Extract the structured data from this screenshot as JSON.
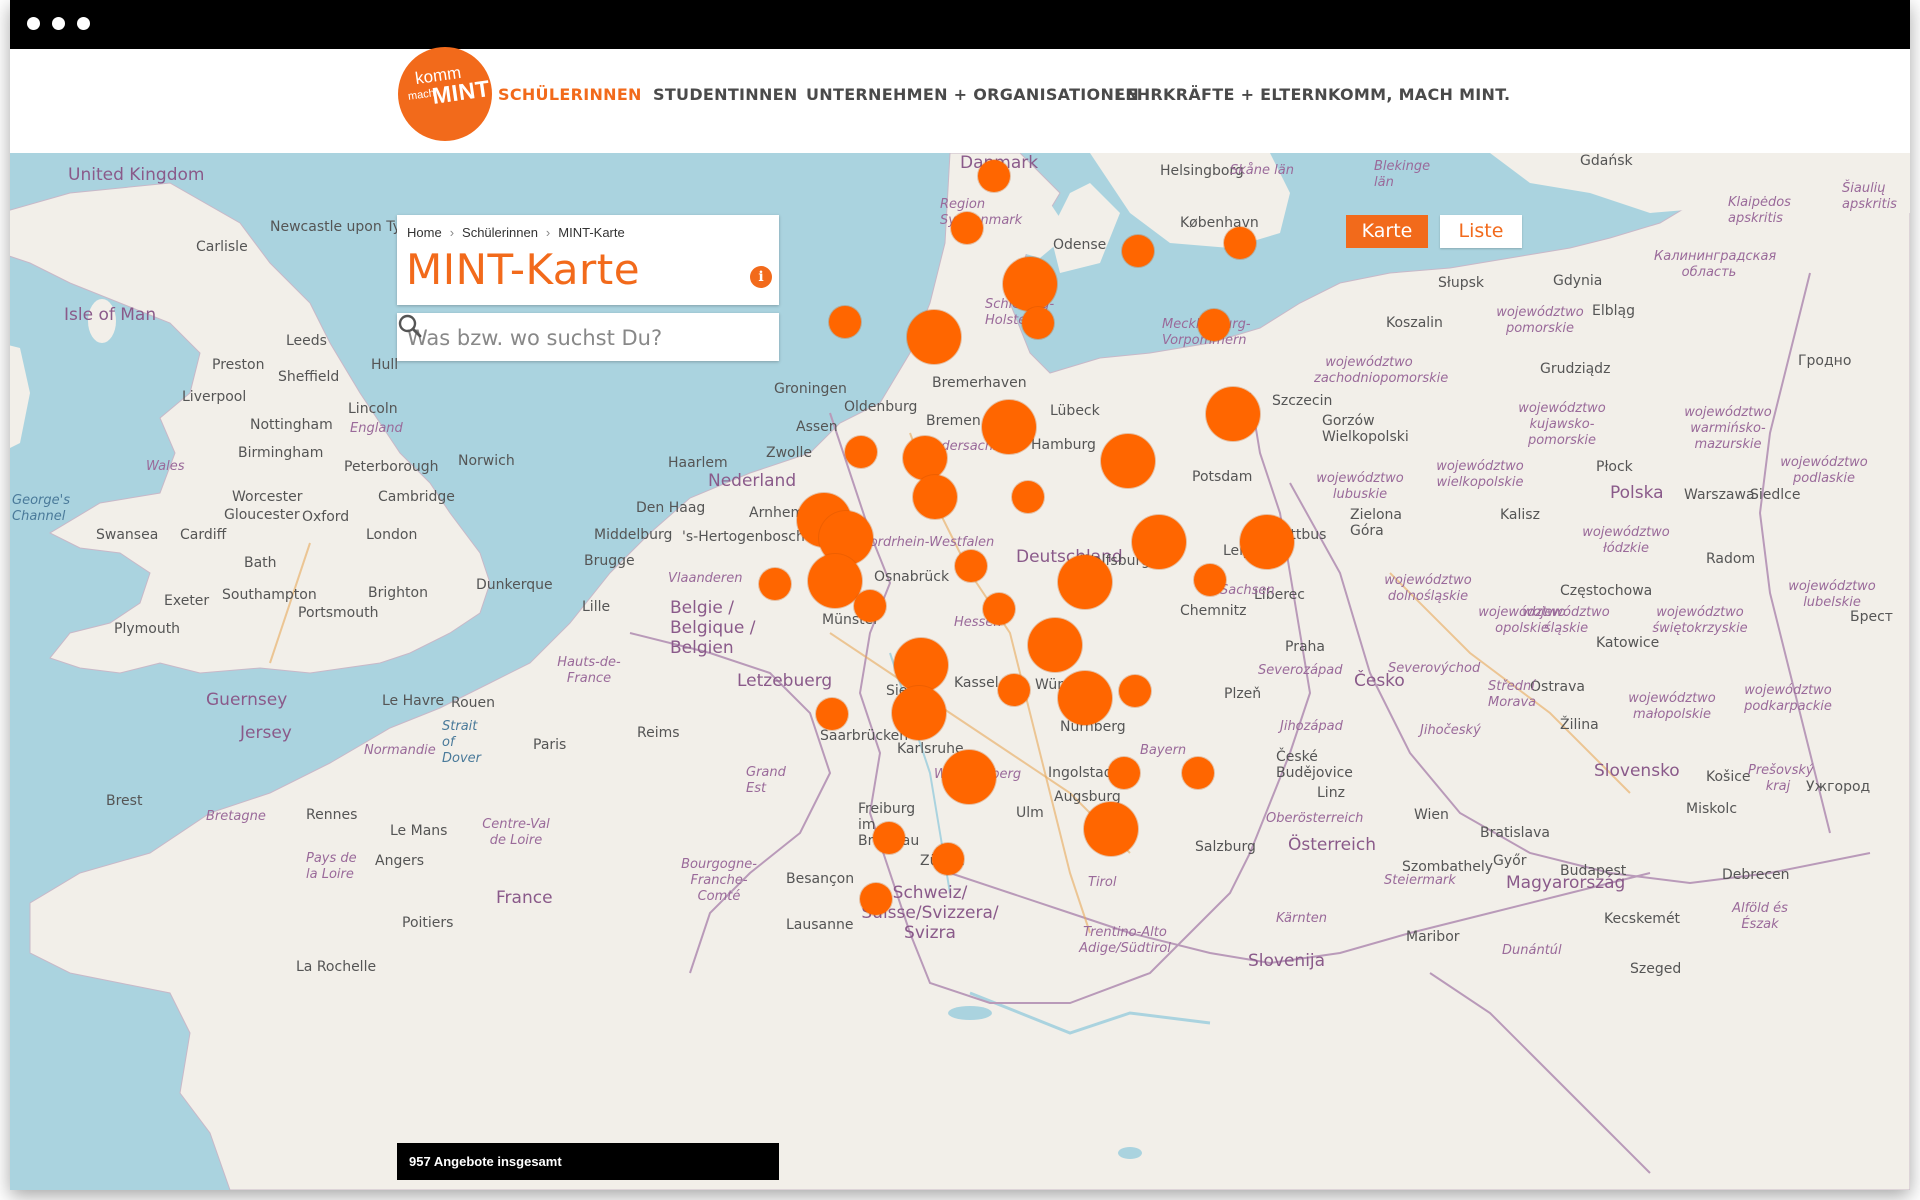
{
  "logo": {
    "line1": "komm",
    "line2": "mach",
    "line3": "MINT"
  },
  "nav": {
    "items": [
      {
        "label": "SCHÜLERINNEN",
        "active": true
      },
      {
        "label": "STUDENTINNEN",
        "active": false
      },
      {
        "label": "UNTERNEHMEN + ORGANISATIONEN",
        "active": false
      },
      {
        "label": "LEHRKRÄFTE + ELTERN",
        "active": false
      },
      {
        "label": "KOMM, MACH MINT.",
        "active": false
      }
    ]
  },
  "breadcrumb": {
    "home": "Home",
    "section": "Schülerinnen",
    "current": "MINT-Karte",
    "separator": "›"
  },
  "page": {
    "title": "MINT-Karte",
    "info_icon": "info-icon",
    "info_glyph": "i"
  },
  "search": {
    "placeholder": "Was bzw. wo suchst Du?",
    "value": "",
    "icon": "search-icon"
  },
  "view_toggle": {
    "map_label": "Karte",
    "list_label": "Liste",
    "active": "Karte"
  },
  "footer": {
    "total_text": "957 Angebote insgesamt"
  },
  "colors": {
    "accent": "#f26a1b",
    "marker": "#ff6600",
    "water": "#aad3df",
    "land": "#f2efe9",
    "nav_text": "#4a4a4a"
  },
  "map_labels": {
    "countries": [
      "United Kingdom",
      "Isle of Man",
      "Nederland",
      "Deutschland",
      "Belgie / Belgique / Belgien",
      "France",
      "Letzebuerg",
      "Schweiz/ Suisse/Svizzera/ Svizra",
      "Česko",
      "Österreich",
      "Polska",
      "Slovensko",
      "Magyarország",
      "Danmark",
      "Guernsey",
      "Jersey",
      "Slovenija"
    ],
    "cities": [
      "Newcastle upon Tyne",
      "Carlisle",
      "Leeds",
      "Preston",
      "Hull",
      "Sheffield",
      "Liverpool",
      "Lincoln",
      "Nottingham",
      "Birmingham",
      "Peterborough",
      "Norwich",
      "Worcester",
      "Cambridge",
      "Gloucester",
      "Oxford",
      "Swansea",
      "Cardiff",
      "London",
      "Bath",
      "Brighton",
      "Southampton",
      "Portsmouth",
      "Exeter",
      "Plymouth",
      "Dunkerque",
      "Lille",
      "Le Havre",
      "Rouen",
      "Paris",
      "Reims",
      "Brest",
      "Rennes",
      "Le Mans",
      "Angers",
      "Poitiers",
      "La Rochelle",
      "Besançon",
      "Lausanne",
      "Zürich",
      "Haarlem",
      "Den Haag",
      "Arnhem",
      "Middelburg",
      "Brugge",
      "'s-Hertogenbosch",
      "Zwolle",
      "Assen",
      "Groningen",
      "Oldenburg",
      "Bremerhaven",
      "Bremen",
      "Osnabrück",
      "Münster",
      "Siegen",
      "Kassel",
      "Wolfsburg",
      "Lübeck",
      "Hamburg",
      "Odense",
      "København",
      "Helsingborg",
      "Saarbrücken",
      "Karlsruhe",
      "Würzburg",
      "Nürnberg",
      "Ingolstadt",
      "Augsburg",
      "Ulm",
      "Freiburg im Breisgau",
      "Salzburg",
      "Linz",
      "Wien",
      "Bratislava",
      "Győr",
      "Budapest",
      "Praha",
      "Plzeň",
      "České Budějovice",
      "Liberec",
      "Chemnitz",
      "Leipzig",
      "Cottbus",
      "Potsdam",
      "Szczecin",
      "Koszalin",
      "Słupsk",
      "Gdynia",
      "Elbląg",
      "Grudziądz",
      "Gorzów Wielkopolski",
      "Zielona Góra",
      "Kalisz",
      "Płock",
      "Warszawa",
      "Siedlce",
      "Radom",
      "Częstochowa",
      "Katowice",
      "Ostrava",
      "Žilina",
      "Košice",
      "Miskolc",
      "Szombathely",
      "Maribor",
      "Kecskemét",
      "Szeged",
      "Debrecen",
      "Ужгород",
      "Gdańsk",
      "Гродно",
      "Брест"
    ],
    "regions": [
      "England",
      "Wales",
      "Niedersachsen",
      "Hessen",
      "Sachsen",
      "Bayern",
      "Württemberg",
      "Mecklenburg-Vorpommern",
      "Schleswig-Holstein",
      "Region Syddanmark",
      "Skåne län",
      "Blekinge län",
      "Normandie",
      "Bretagne",
      "Centre-Val de Loire",
      "Pays de la Loire",
      "Bourgogne-Franche-Comté",
      "Grand Est",
      "Hauts-de-France",
      "Vlaanderen",
      "Nordrhein-Westfalen",
      "Severozápad",
      "Severovýchod",
      "Jihozápad",
      "Jihočeský",
      "Střední Morava",
      "Oberösterreich",
      "Steiermark",
      "Kärnten",
      "Tirol",
      "Trentino-Alto Adige/Südtirol",
      "Dunántúl",
      "województwo pomorskie",
      "województwo zachodniopomorskie",
      "województwo kujawsko-pomorskie",
      "województwo wielkopolskie",
      "województwo lubuskie",
      "województwo dolnośląskie",
      "województwo opolskie",
      "województwo łódzkie",
      "województwo śląskie",
      "województwo świętokrzyskie",
      "województwo małopolskie",
      "województwo podkarpackie",
      "województwo lubelskie",
      "województwo podlaskie",
      "województwo warmińsko-mazurskie",
      "Калининградская область",
      "Šiaulių apskritis",
      "Klaipėdos apskritis",
      "Prešovský kraj",
      "Alföld és Észak",
      "Strait of Dover",
      "George's Channel"
    ]
  },
  "markers": [
    {
      "id": "marker-1",
      "size": "small"
    },
    {
      "id": "marker-2",
      "size": "small"
    },
    {
      "id": "marker-3",
      "size": "large"
    },
    {
      "id": "marker-4",
      "size": "small"
    },
    {
      "id": "marker-5",
      "size": "small"
    },
    {
      "id": "marker-6",
      "size": "small"
    },
    {
      "id": "marker-7",
      "size": "large"
    },
    {
      "id": "marker-8",
      "size": "small"
    },
    {
      "id": "marker-9",
      "size": "small"
    },
    {
      "id": "marker-10",
      "size": "large"
    },
    {
      "id": "marker-11",
      "size": "large"
    },
    {
      "id": "marker-12",
      "size": "small"
    },
    {
      "id": "marker-13",
      "size": "medium"
    },
    {
      "id": "marker-14",
      "size": "large"
    },
    {
      "id": "marker-15",
      "size": "medium"
    },
    {
      "id": "marker-16",
      "size": "small"
    },
    {
      "id": "marker-17",
      "size": "large"
    },
    {
      "id": "marker-18",
      "size": "large"
    },
    {
      "id": "marker-19",
      "size": "large"
    },
    {
      "id": "marker-20",
      "size": "large"
    },
    {
      "id": "marker-21",
      "size": "small"
    },
    {
      "id": "marker-22",
      "size": "small"
    },
    {
      "id": "marker-23",
      "size": "large"
    },
    {
      "id": "marker-24",
      "size": "large"
    },
    {
      "id": "marker-25",
      "size": "small"
    },
    {
      "id": "marker-26",
      "size": "small"
    },
    {
      "id": "marker-27",
      "size": "small"
    },
    {
      "id": "marker-28",
      "size": "small"
    },
    {
      "id": "marker-29",
      "size": "large"
    },
    {
      "id": "marker-30",
      "size": "small"
    },
    {
      "id": "marker-31",
      "size": "large"
    },
    {
      "id": "marker-32",
      "size": "small"
    },
    {
      "id": "marker-33",
      "size": "large"
    },
    {
      "id": "marker-34",
      "size": "small"
    },
    {
      "id": "marker-35",
      "size": "large"
    },
    {
      "id": "marker-36",
      "size": "small"
    },
    {
      "id": "marker-37",
      "size": "large"
    },
    {
      "id": "marker-38",
      "size": "small"
    },
    {
      "id": "marker-39",
      "size": "large"
    },
    {
      "id": "marker-40",
      "size": "small"
    },
    {
      "id": "marker-41",
      "size": "small"
    },
    {
      "id": "marker-42",
      "size": "small"
    }
  ]
}
